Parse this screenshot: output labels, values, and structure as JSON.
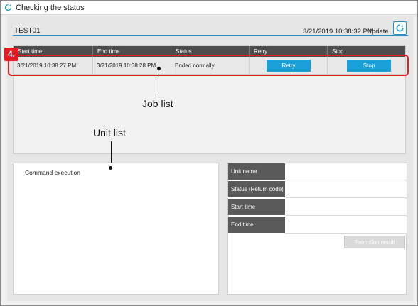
{
  "window": {
    "title": "Checking the status",
    "icon": "refresh-circle-icon"
  },
  "header": {
    "job_name": "TEST01",
    "timestamp": "3/21/2019 10:38:32 PM",
    "update_label": "Update",
    "update_icon": "refresh-icon"
  },
  "job_list": {
    "columns": [
      "Start time",
      "End time",
      "Status",
      "Retry",
      "Stop"
    ],
    "rows": [
      {
        "start_time": "3/21/2019 10:38:27 PM",
        "end_time": "3/21/2019 10:38:28 PM",
        "status": "Ended normally",
        "retry_label": "Retry",
        "stop_label": "Stop"
      }
    ]
  },
  "annotations": {
    "callout_number": "4.",
    "job_list_label": "Job list",
    "unit_list_label": "Unit list"
  },
  "unit_list": {
    "items": [
      "Command execution"
    ]
  },
  "unit_detail": {
    "fields": [
      {
        "label": "Unit name",
        "value": ""
      },
      {
        "label": "Status (Return code)",
        "value": ""
      },
      {
        "label": "Start time",
        "value": ""
      },
      {
        "label": "End time",
        "value": ""
      }
    ],
    "execution_result_label": "Execution result"
  },
  "colors": {
    "accent": "#1a9fd8",
    "callout": "#e41b23",
    "header_dark": "#4d4d4d"
  }
}
